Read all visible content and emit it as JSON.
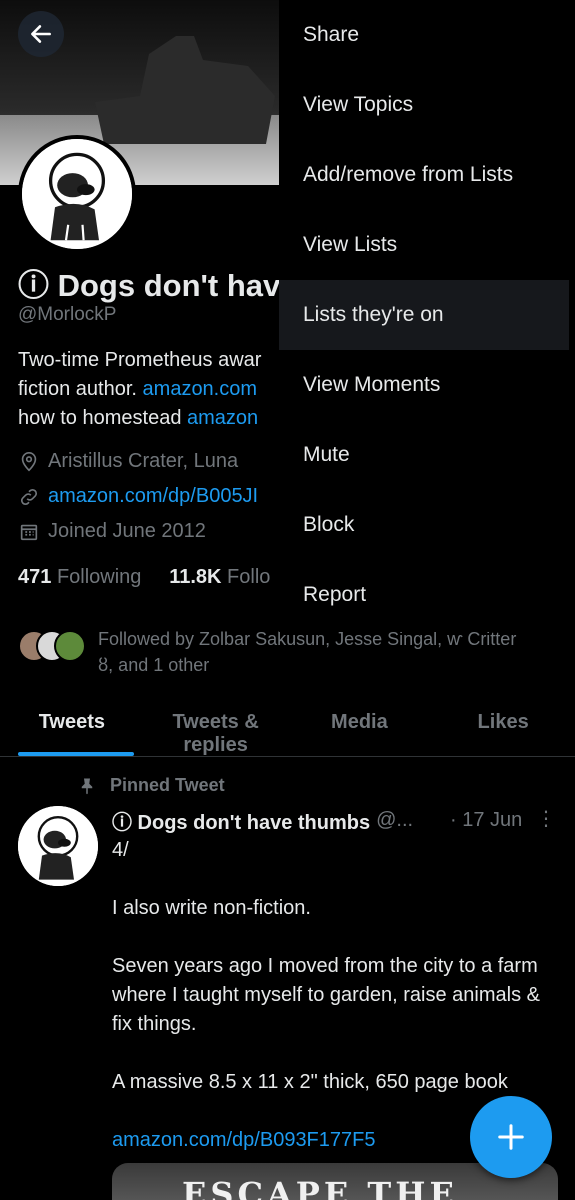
{
  "profile": {
    "name": "ⓘ Dogs don't hav",
    "handle": "@MorlockP",
    "bio_line1": "Two-time Prometheus awar",
    "bio_line2_text": "fiction author. ",
    "bio_line2_link": "amazon.com",
    "bio_line3_text": "how to homestead ",
    "bio_line3_link": "amazon",
    "location": "Aristillus Crater, Luna",
    "website": "amazon.com/dp/B005JI",
    "joined": "Joined June 2012",
    "following_count": "471",
    "following_label": "Following",
    "followers_count": "11.8K",
    "followers_label": "Follo",
    "followed_by_line1": "Followed by Zolbar Sakusun, Jesse Singal, ⱳ Critter",
    "followed_by_line2": "ȣ, and 1 other"
  },
  "tabs": [
    "Tweets",
    "Tweets & replies",
    "Media",
    "Likes"
  ],
  "tweet": {
    "pinned_label": "Pinned Tweet",
    "author_name": "ⓘ Dogs don't have thumbs",
    "author_handle": "@...",
    "date": "· 17 Jun",
    "more": "⋮",
    "line_counter": "4/",
    "para1": "I also write non-fiction.",
    "para2": "Seven years ago I moved from the city to a farm where I taught myself to garden, raise animals & fix things.",
    "para3": "A massive 8.5 x 11 x 2\" thick, 650 page book",
    "link": "amazon.com/dp/B093F177F5",
    "media_text": "ESCAPE THE CITY"
  },
  "menu": {
    "items": [
      "Share",
      "View Topics",
      "Add/remove from Lists",
      "View Lists",
      "Lists they're on",
      "View Moments",
      "Mute",
      "Block",
      "Report"
    ],
    "highlighted_index": 4
  },
  "icons": {
    "back": "arrow-left-icon",
    "location": "location-pin-icon",
    "link": "link-icon",
    "calendar": "calendar-icon",
    "pin": "pin-icon",
    "compose": "plus-icon"
  },
  "colors": {
    "accent": "#1d9bf0",
    "text": "#e7e9ea",
    "muted": "#71767b",
    "background": "#000000"
  }
}
